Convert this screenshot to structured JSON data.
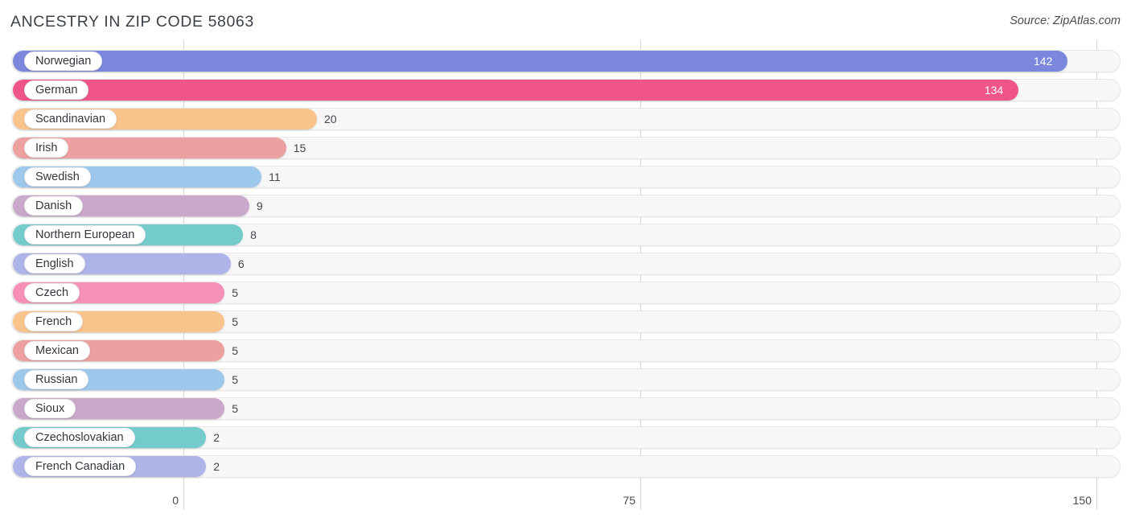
{
  "header": {
    "title": "ANCESTRY IN ZIP CODE 58063",
    "source": "Source: ZipAtlas.com"
  },
  "chart_data": {
    "type": "bar",
    "orientation": "horizontal",
    "title": "ANCESTRY IN ZIP CODE 58063",
    "xlabel": "",
    "ylabel": "",
    "xlim": [
      0,
      150
    ],
    "xticks": [
      "0",
      "75",
      "150"
    ],
    "xtick_values": [
      0,
      75,
      150
    ],
    "grid": true,
    "legend": "none",
    "categories": [
      "Norwegian",
      "German",
      "Scandinavian",
      "Irish",
      "Swedish",
      "Danish",
      "Northern European",
      "English",
      "Czech",
      "French",
      "Mexican",
      "Russian",
      "Sioux",
      "Czechoslovakian",
      "French Canadian"
    ],
    "values": [
      142,
      134,
      20,
      15,
      11,
      9,
      8,
      6,
      5,
      5,
      5,
      5,
      5,
      2,
      2
    ],
    "value_labels": [
      "142",
      "134",
      "20",
      "15",
      "11",
      "9",
      "8",
      "6",
      "5",
      "5",
      "5",
      "5",
      "5",
      "2",
      "2"
    ],
    "colors": [
      "#7b87dd",
      "#ef5586",
      "#f9c48b",
      "#eda0a0",
      "#9ec7ec",
      "#c9a8cc",
      "#74cbcb",
      "#aeb4e8",
      "#f790b8",
      "#f9c48b",
      "#eda0a0",
      "#9ec7ec",
      "#c9a8cc",
      "#74cbcb",
      "#aeb4e8"
    ],
    "label_inside": [
      true,
      true,
      false,
      false,
      false,
      false,
      false,
      false,
      false,
      false,
      false,
      false,
      false,
      false,
      false
    ]
  },
  "theme": {
    "track_fill": "#f7f7f7",
    "track_border": "#e6e6e6",
    "gridline": "#d6d6d6",
    "text": "#41454b",
    "title_text": "#3c4149"
  }
}
